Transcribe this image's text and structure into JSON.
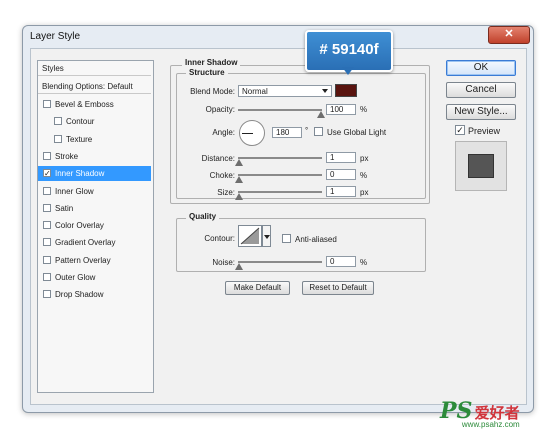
{
  "window": {
    "title": "Layer Style",
    "close_glyph": "✕"
  },
  "styles_panel": {
    "header": "Styles",
    "blending_options": "Blending Options: Default",
    "items": [
      {
        "label": "Bevel & Emboss",
        "checked": false,
        "indent": false
      },
      {
        "label": "Contour",
        "checked": false,
        "indent": true
      },
      {
        "label": "Texture",
        "checked": false,
        "indent": true
      },
      {
        "label": "Stroke",
        "checked": false,
        "indent": false
      },
      {
        "label": "Inner Shadow",
        "checked": true,
        "indent": false,
        "selected": true
      },
      {
        "label": "Inner Glow",
        "checked": false,
        "indent": false
      },
      {
        "label": "Satin",
        "checked": false,
        "indent": false
      },
      {
        "label": "Color Overlay",
        "checked": false,
        "indent": false
      },
      {
        "label": "Gradient Overlay",
        "checked": false,
        "indent": false
      },
      {
        "label": "Pattern Overlay",
        "checked": false,
        "indent": false
      },
      {
        "label": "Outer Glow",
        "checked": false,
        "indent": false
      },
      {
        "label": "Drop Shadow",
        "checked": false,
        "indent": false
      }
    ]
  },
  "inner_shadow": {
    "section_title": "Inner Shadow",
    "structure": {
      "title": "Structure",
      "blend_mode_label": "Blend Mode:",
      "blend_mode_value": "Normal",
      "color": "#59140f",
      "opacity_label": "Opacity:",
      "opacity_value": "100",
      "opacity_unit": "%",
      "angle_label": "Angle:",
      "angle_value": "180",
      "angle_unit": "°",
      "global_light_label": "Use Global Light",
      "global_light_checked": false,
      "distance_label": "Distance:",
      "distance_value": "1",
      "distance_unit": "px",
      "choke_label": "Choke:",
      "choke_value": "0",
      "choke_unit": "%",
      "size_label": "Size:",
      "size_value": "1",
      "size_unit": "px"
    },
    "quality": {
      "title": "Quality",
      "contour_label": "Contour:",
      "anti_aliased_label": "Anti-aliased",
      "noise_label": "Noise:",
      "noise_value": "0",
      "noise_unit": "%"
    },
    "make_default_label": "Make Default",
    "reset_default_label": "Reset to Default"
  },
  "buttons": {
    "ok": "OK",
    "cancel": "Cancel",
    "new_style": "New Style..."
  },
  "preview": {
    "label": "Preview",
    "checked": true,
    "swatch_color": "#555555"
  },
  "callout": {
    "text": "# 59140f",
    "color": "#3a86cb"
  },
  "watermark": {
    "brand": "PS",
    "chinese": "爱好者",
    "url": "www.psahz.com"
  }
}
